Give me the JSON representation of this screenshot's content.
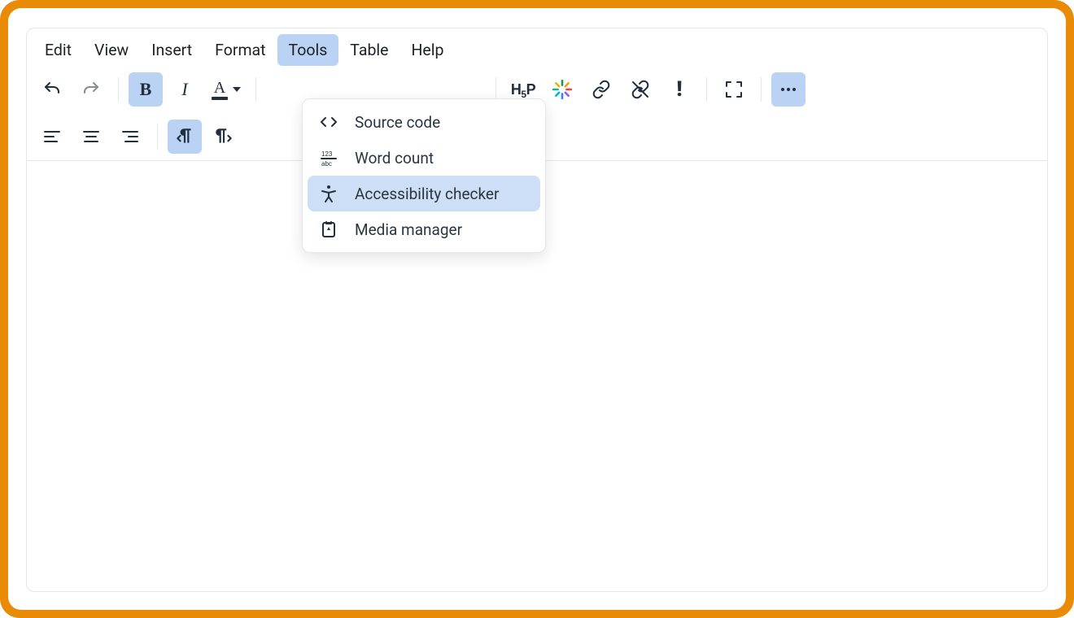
{
  "menubar": {
    "items": [
      "Edit",
      "View",
      "Insert",
      "Format",
      "Tools",
      "Table",
      "Help"
    ],
    "active_index": 4
  },
  "toolbar_icons": {
    "undo": "undo-icon",
    "redo": "redo-icon",
    "bold": "bold-icon",
    "italic": "italic-icon",
    "textcolor": "text-color-icon",
    "h5p": "h5p-icon",
    "starburst": "starburst-icon",
    "link": "link-icon",
    "unlink": "unlink-icon",
    "exclaim": "exclaim-icon",
    "fullscreen": "fullscreen-icon",
    "more": "more-icon",
    "alignleft": "align-left-icon",
    "aligncenter": "align-center-icon",
    "alignright": "align-right-icon",
    "outdent_rtl": "outdent-rtl-icon",
    "indent_ltr": "indent-ltr-icon"
  },
  "dropdown": {
    "items": [
      {
        "label": "Source code",
        "icon": "code-icon"
      },
      {
        "label": "Word count",
        "icon": "word-count-icon"
      },
      {
        "label": "Accessibility checker",
        "icon": "accessibility-icon"
      },
      {
        "label": "Media manager",
        "icon": "media-manager-icon"
      }
    ],
    "highlight_index": 2
  },
  "colors": {
    "accent": "#bad2f4",
    "frame": "#e98b06"
  }
}
